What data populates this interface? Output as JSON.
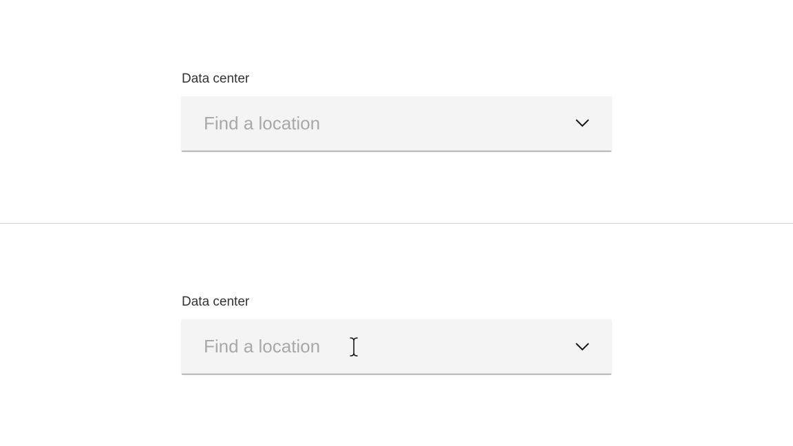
{
  "example_closed": {
    "label": "Data center",
    "placeholder": "Find a location",
    "value": ""
  },
  "example_hover": {
    "label": "Data center",
    "placeholder": "Find a location",
    "value": ""
  }
}
